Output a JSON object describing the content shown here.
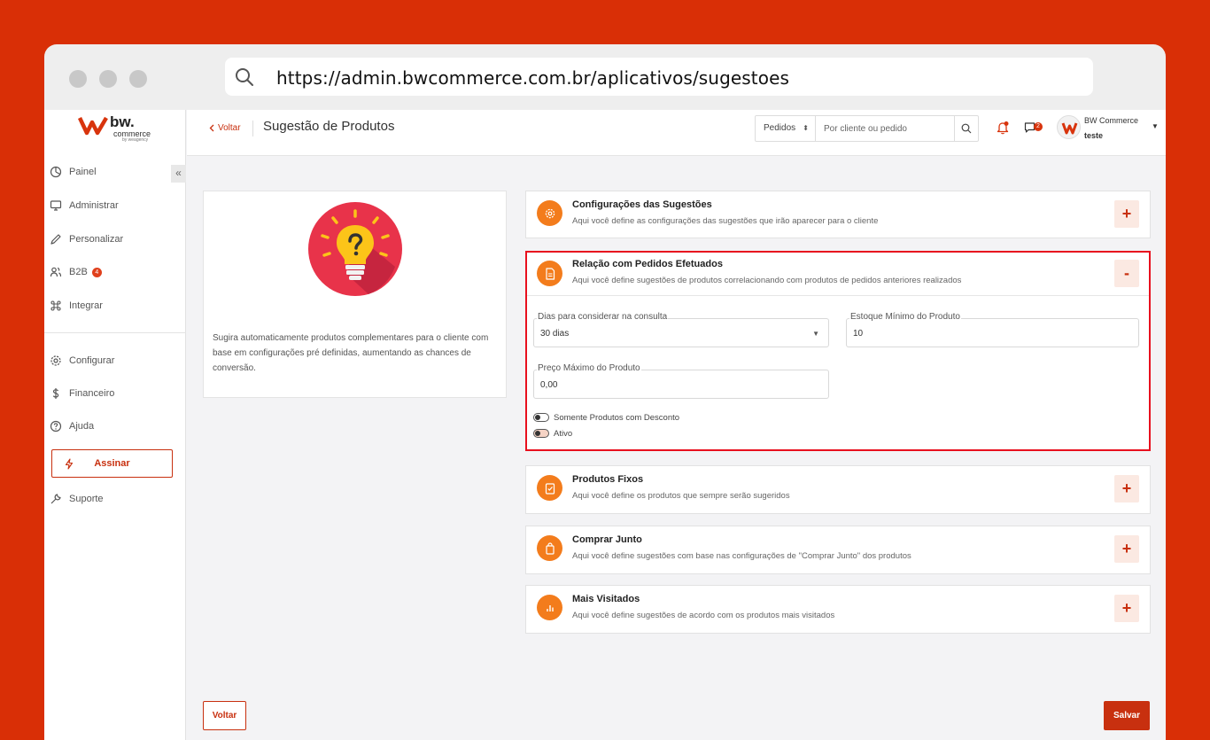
{
  "browser": {
    "url": "https://admin.bwcommerce.com.br/aplicativos/sugestoes"
  },
  "brand": {
    "logo_text": "bw.",
    "logo_sub": "commerce",
    "logo_tiny": "by weagency"
  },
  "sidebar": {
    "items": [
      {
        "label": "Painel"
      },
      {
        "label": "Administrar"
      },
      {
        "label": "Personalizar"
      },
      {
        "label": "B2B",
        "badge": "4"
      },
      {
        "label": "Integrar"
      },
      {
        "label": "Configurar"
      },
      {
        "label": "Financeiro"
      },
      {
        "label": "Ajuda"
      }
    ],
    "assinar_label": "Assinar",
    "suporte_label": "Suporte",
    "collapse_glyph": "«"
  },
  "topbar": {
    "back_label": "Voltar",
    "page_title": "Sugestão de Produtos",
    "search_scope": "Pedidos",
    "search_placeholder": "Por cliente ou pedido",
    "chat_badge": "2",
    "user_name": "BW Commerce",
    "user_sub": "teste"
  },
  "info_card": {
    "description": "Sugira automaticamente produtos complementares para o cliente com base em configurações pré definidas, aumentando as chances de conversão."
  },
  "sections": [
    {
      "title": "Configurações das Sugestões",
      "desc": "Aqui você define as configurações das sugestões que irão aparecer para o cliente",
      "toggle": "+"
    },
    {
      "title": "Relação com Pedidos Efetuados",
      "desc": "Aqui você define sugestões de produtos correlacionando com produtos de pedidos anteriores realizados",
      "toggle": "-"
    },
    {
      "title": "Produtos Fixos",
      "desc": "Aqui você define os produtos que sempre serão sugeridos",
      "toggle": "+"
    },
    {
      "title": "Comprar Junto",
      "desc": "Aqui você define sugestões com base nas configurações de \"Comprar Junto\" dos produtos",
      "toggle": "+"
    },
    {
      "title": "Mais Visitados",
      "desc": "Aqui você define sugestões de acordo com os produtos mais visitados",
      "toggle": "+"
    }
  ],
  "form": {
    "dias_label": "Dias para considerar na consulta",
    "dias_value": "30 dias",
    "estoque_label": "Estoque Mínimo do Produto",
    "estoque_value": "10",
    "preco_label": "Preço Máximo do Produto",
    "preco_value": "0,00",
    "switch_desconto": "Somente Produtos com Desconto",
    "switch_ativo": "Ativo"
  },
  "footer": {
    "voltar_label": "Voltar",
    "salvar_label": "Salvar"
  },
  "colors": {
    "brand": "#c8300f",
    "background": "#d92f06",
    "accent_orange": "#f37c1c",
    "active_border": "#e8101e"
  }
}
